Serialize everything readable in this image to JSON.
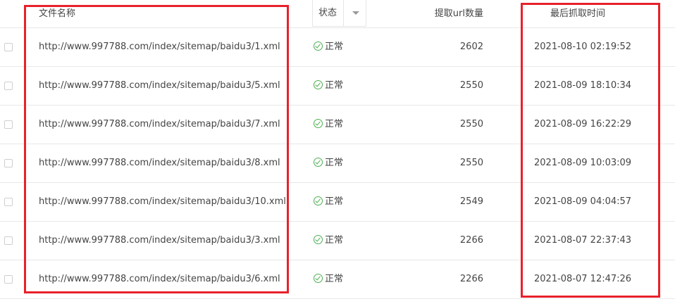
{
  "header": {
    "file_name": "文件名称",
    "status": "状态",
    "url_count": "提取url数量",
    "last_crawl_time": "最后抓取时间"
  },
  "colors": {
    "highlight": "#e8212b",
    "status_ok": "#4caf50"
  },
  "rows": [
    {
      "file": "http://www.997788.com/index/sitemap/baidu3/1.xml",
      "status": "正常",
      "count": "2602",
      "time": "2021-08-10 02:19:52"
    },
    {
      "file": "http://www.997788.com/index/sitemap/baidu3/5.xml",
      "status": "正常",
      "count": "2550",
      "time": "2021-08-09 18:10:34"
    },
    {
      "file": "http://www.997788.com/index/sitemap/baidu3/7.xml",
      "status": "正常",
      "count": "2550",
      "time": "2021-08-09 16:22:29"
    },
    {
      "file": "http://www.997788.com/index/sitemap/baidu3/8.xml",
      "status": "正常",
      "count": "2550",
      "time": "2021-08-09 10:03:09"
    },
    {
      "file": "http://www.997788.com/index/sitemap/baidu3/10.xml",
      "status": "正常",
      "count": "2549",
      "time": "2021-08-09 04:04:57"
    },
    {
      "file": "http://www.997788.com/index/sitemap/baidu3/3.xml",
      "status": "正常",
      "count": "2266",
      "time": "2021-08-07 22:37:43"
    },
    {
      "file": "http://www.997788.com/index/sitemap/baidu3/6.xml",
      "status": "正常",
      "count": "2266",
      "time": "2021-08-07 12:47:26"
    }
  ]
}
